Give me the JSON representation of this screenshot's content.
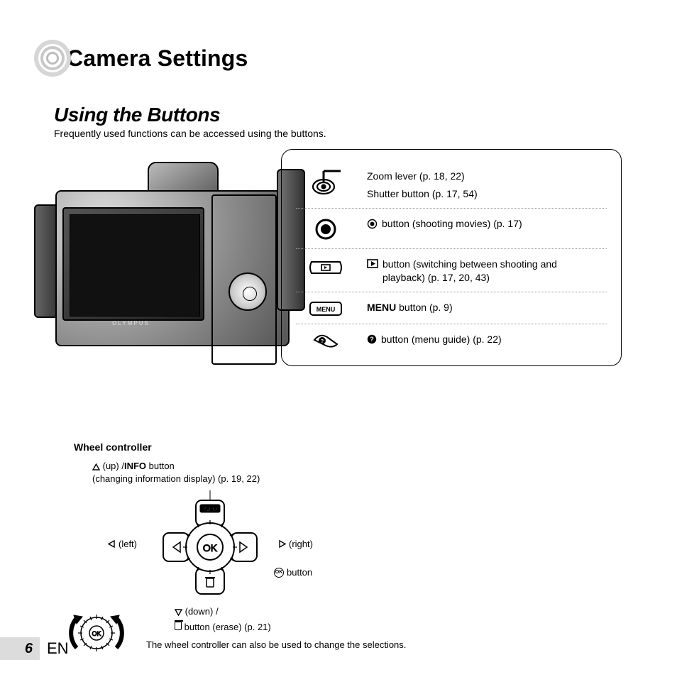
{
  "header": {
    "title": "Camera Settings"
  },
  "section": {
    "title": "Using the Buttons",
    "intro": "Frequently used functions can be accessed using the buttons."
  },
  "camera_brand": "OLYMPUS",
  "legend": {
    "items": [
      {
        "line1": "Zoom lever (p. 18, 22)",
        "line2": "Shutter button (p. 17, 54)"
      },
      {
        "text": "button (shooting movies) (p. 17)"
      },
      {
        "text": "button (switching between shooting and playback) (p. 17, 20, 43)"
      },
      {
        "prefix": "MENU",
        "text": " button (p. 9)"
      },
      {
        "text": "button (menu guide) (p. 22)"
      }
    ]
  },
  "wheel": {
    "title": "Wheel controller",
    "up_prefix": "(up) /",
    "up_bold": "INFO",
    "up_suffix": " button",
    "up_line2": "(changing information display) (p. 19, 22)",
    "left": "(left)",
    "right": "(right)",
    "ok_button": "button",
    "down_line1": "(down) /",
    "down_line2": "button (erase) (p. 21)",
    "note": "The wheel controller can also be used  to change the selections."
  },
  "footer": {
    "page": "6",
    "lang": "EN"
  }
}
